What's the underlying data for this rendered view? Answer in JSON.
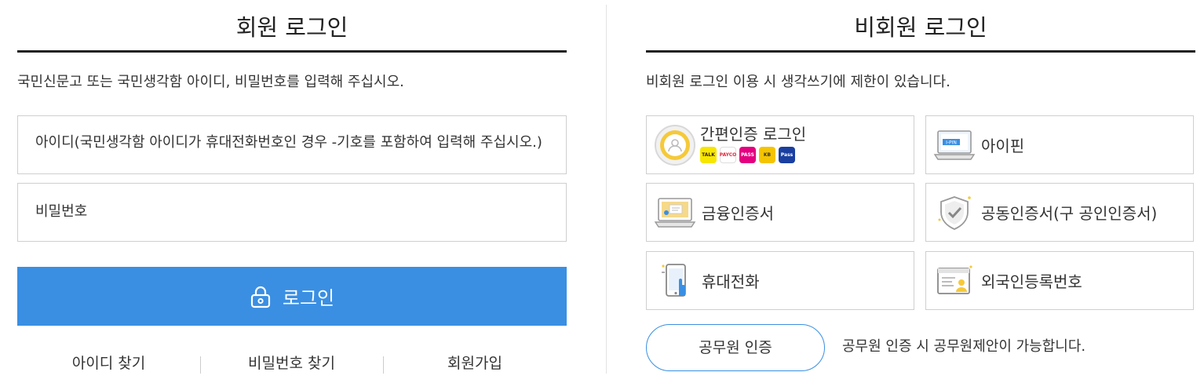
{
  "member": {
    "title": "회원 로그인",
    "description": "국민신문고 또는 국민생각함 아이디, 비밀번호를 입력해 주십시오.",
    "id_placeholder": "아이디(국민생각함 아이디가 휴대전화번호인 경우 -기호를 포함하여 입력해 주십시오.)",
    "password_placeholder": "비밀번호",
    "login_label": "로그인",
    "links": {
      "find_id": "아이디 찾기",
      "find_password": "비밀번호 찾기",
      "signup": "회원가입"
    }
  },
  "guest": {
    "title": "비회원 로그인",
    "description": "비회원 로그인 이용 시 생각쓰기에 제한이 있습니다.",
    "options": {
      "simple_auth": "간편인증 로그인",
      "ipin": "아이핀",
      "financial_cert": "금융인증서",
      "joint_cert": "공동인증서(구 공인인증서)",
      "mobile": "휴대전화",
      "foreigner": "외국인등록번호"
    },
    "simple_auth_badges": [
      {
        "name": "kakao-badge",
        "text": "TALK",
        "color": "#f7e600"
      },
      {
        "name": "payco-badge",
        "text": "PAYCO",
        "color": "#e8233b"
      },
      {
        "name": "pass-badge",
        "text": "PASS",
        "color": "#e4007f"
      },
      {
        "name": "kb-badge",
        "text": "KB",
        "color": "#f5c400"
      },
      {
        "name": "samsung-pass-badge",
        "text": "Pass",
        "color": "#1a3fa0"
      }
    ],
    "gov_button": "공무원 인증",
    "gov_note": "공무원 인증 시 공무원제안이 가능합니다."
  },
  "colors": {
    "accent": "#3a8fe3",
    "border": "#cfcfcf",
    "title_rule": "#222222"
  }
}
